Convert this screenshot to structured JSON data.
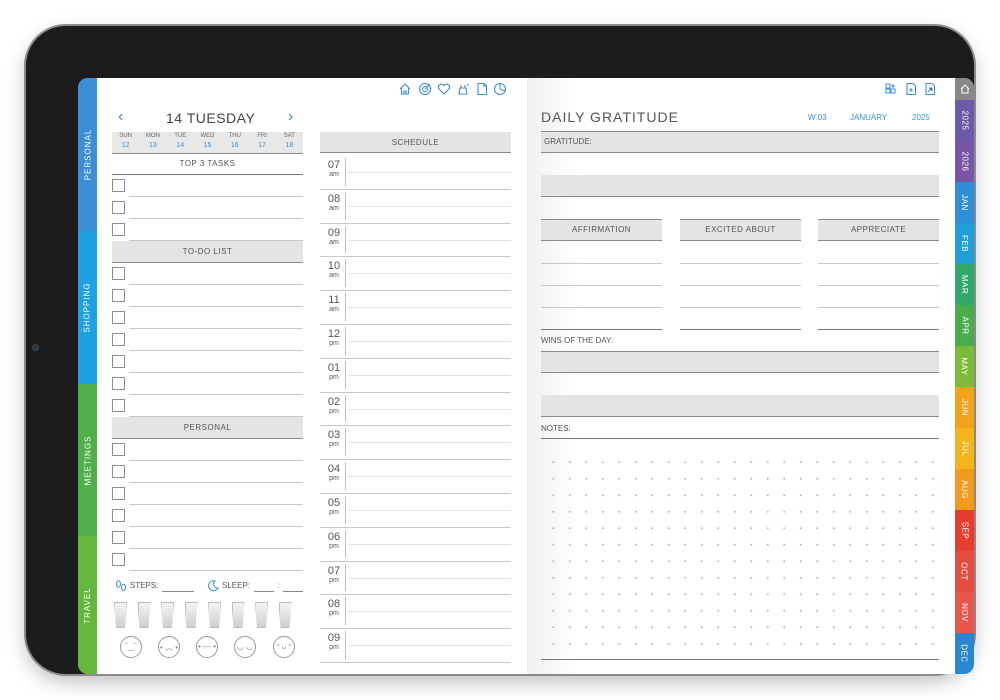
{
  "left_tabs": [
    {
      "label": "PERSONAL",
      "color": "#3b8fd6"
    },
    {
      "label": "SHOPPING",
      "color": "#1da1e2"
    },
    {
      "label": "MEETINGS",
      "color": "#4fb049"
    },
    {
      "label": "TRAVEL",
      "color": "#63b83c"
    }
  ],
  "right_tabs": [
    {
      "label": "2025",
      "color": "#6d5aa8"
    },
    {
      "label": "2026",
      "color": "#7a55a5"
    },
    {
      "label": "JAN",
      "color": "#2f8ed8"
    },
    {
      "label": "FEB",
      "color": "#1e9fd8"
    },
    {
      "label": "MAR",
      "color": "#2fa86a"
    },
    {
      "label": "APR",
      "color": "#49ad4e"
    },
    {
      "label": "MAY",
      "color": "#7cbb38"
    },
    {
      "label": "JUN",
      "color": "#f4a21a"
    },
    {
      "label": "JUL",
      "color": "#f5b41e"
    },
    {
      "label": "AUG",
      "color": "#f39a1c"
    },
    {
      "label": "SEP",
      "color": "#e73d2e"
    },
    {
      "label": "OCT",
      "color": "#e44c3f"
    },
    {
      "label": "NOV",
      "color": "#e8574a"
    },
    {
      "label": "DEC",
      "color": "#2a86d1"
    }
  ],
  "day_header": {
    "title": "14 TUESDAY",
    "prev": "‹",
    "next": "›"
  },
  "week": {
    "days": [
      "SUN",
      "MON",
      "TUE",
      "WED",
      "THU",
      "FRI",
      "SAT"
    ],
    "dates": [
      "12",
      "13",
      "14",
      "15",
      "16",
      "17",
      "18"
    ]
  },
  "sections": {
    "top3": "TOP 3 TASKS",
    "todo": "TO-DO LIST",
    "personal": "PERSONAL",
    "schedule": "SCHEDULE"
  },
  "trackers": {
    "steps": "STEPS:",
    "sleep": "SLEEP:",
    "sleep_sep": ":"
  },
  "hours": [
    {
      "n": "07",
      "ap": "am"
    },
    {
      "n": "08",
      "ap": "am"
    },
    {
      "n": "09",
      "ap": "am"
    },
    {
      "n": "10",
      "ap": "am"
    },
    {
      "n": "11",
      "ap": "am"
    },
    {
      "n": "12",
      "ap": "pm"
    },
    {
      "n": "01",
      "ap": "pm"
    },
    {
      "n": "02",
      "ap": "pm"
    },
    {
      "n": "03",
      "ap": "pm"
    },
    {
      "n": "04",
      "ap": "pm"
    },
    {
      "n": "05",
      "ap": "pm"
    },
    {
      "n": "06",
      "ap": "pm"
    },
    {
      "n": "07",
      "ap": "pm"
    },
    {
      "n": "08",
      "ap": "pm"
    },
    {
      "n": "09",
      "ap": "pm"
    }
  ],
  "gratitude": {
    "title": "DAILY GRATITUDE",
    "week": "W 03",
    "month": "JANUARY",
    "year": "2025",
    "gratitude_label": "GRATITUDE:",
    "affirmation": "AFFIRMATION",
    "excited": "EXCITED ABOUT",
    "appreciate": "APPRECIATE",
    "wins": "WINS OF THE DAY:",
    "notes": "NOTES:"
  },
  "icons_left": [
    "home-icon",
    "target-icon",
    "heart-icon",
    "habit-icon",
    "document-icon",
    "pie-chart-icon"
  ],
  "icons_right": [
    "grid-add-icon",
    "file-add-icon",
    "file-link-icon"
  ],
  "accent": "#3a8fd8"
}
